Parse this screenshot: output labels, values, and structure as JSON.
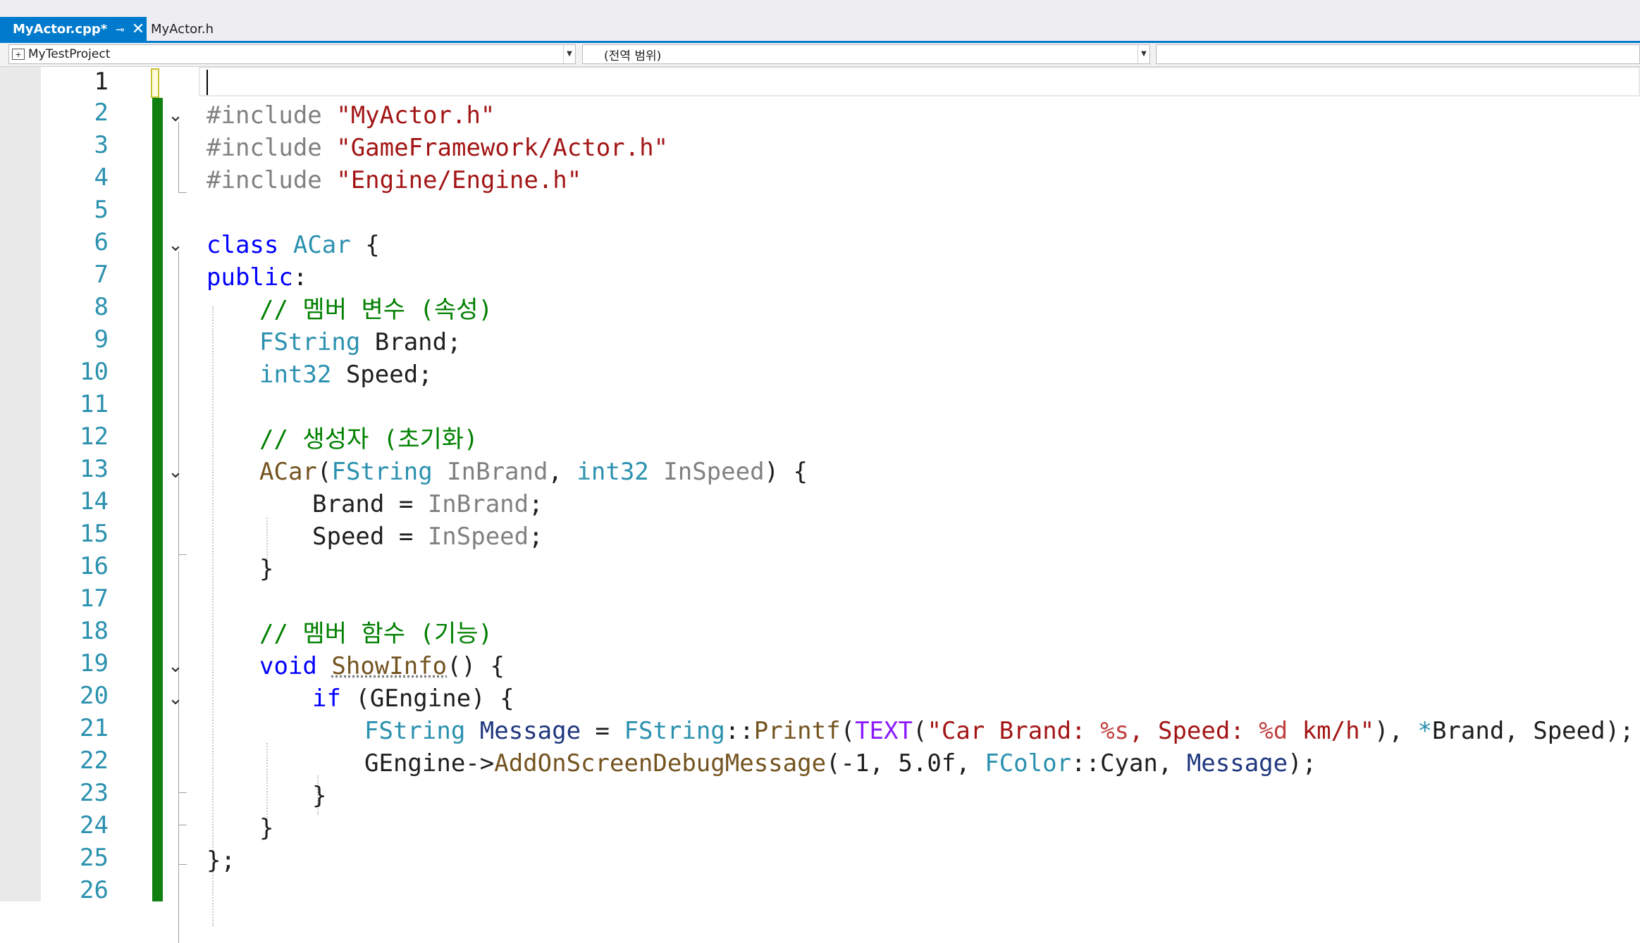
{
  "tabs": [
    {
      "label": "MyActor.cpp*",
      "pin": "⊸",
      "close": "✕"
    },
    {
      "label": "MyActor.h"
    }
  ],
  "nav": {
    "project": "MyTestProject",
    "scope": "(전역 범위)",
    "member": ""
  },
  "line_numbers": [
    "1",
    "2",
    "3",
    "4",
    "5",
    "6",
    "7",
    "8",
    "9",
    "10",
    "11",
    "12",
    "13",
    "14",
    "15",
    "16",
    "17",
    "18",
    "19",
    "20",
    "21",
    "22",
    "23",
    "24",
    "25",
    "26"
  ],
  "code": {
    "l2": [
      "#include ",
      "\"MyActor.h\""
    ],
    "l3": [
      "#include ",
      "\"GameFramework/Actor.h\""
    ],
    "l4": [
      "#include ",
      "\"Engine/Engine.h\""
    ],
    "l6": [
      "class",
      " ",
      "ACar",
      " {"
    ],
    "l7": [
      "public",
      ":"
    ],
    "l8": [
      "// 멤버 변수 (속성)"
    ],
    "l9": [
      "FString",
      " Brand;"
    ],
    "l10": [
      "int32",
      " Speed;"
    ],
    "l12": [
      "// 생성자 (초기화)"
    ],
    "l13": [
      "ACar",
      "(",
      "FString",
      " ",
      "InBrand",
      ", ",
      "int32",
      " ",
      "InSpeed",
      ") {"
    ],
    "l14": [
      "Brand",
      " ",
      "=",
      " ",
      "InBrand",
      ";"
    ],
    "l15": [
      "Speed",
      " ",
      "=",
      " ",
      "InSpeed",
      ";"
    ],
    "l16": [
      "}"
    ],
    "l18": [
      "// 멤버 함수 (기능)"
    ],
    "l19": [
      "void",
      " ",
      "ShowInfo",
      "() {"
    ],
    "l20": [
      "if",
      " (GEngine) {"
    ],
    "l21": [
      "FString",
      " ",
      "Message",
      " = ",
      "FString",
      "::",
      "Printf",
      "(",
      "TEXT",
      "(",
      "\"Car Brand: ",
      "%s",
      ", Speed: ",
      "%d",
      " km/h\"",
      "), ",
      "*",
      "Brand, Speed);"
    ],
    "l22": [
      "GEngine->",
      "AddOnScreenDebugMessage",
      "(-1, 5.0f, ",
      "FColor",
      "::",
      "Cyan, ",
      "Message",
      ");"
    ],
    "l23": [
      "}"
    ],
    "l24": [
      "}"
    ],
    "l25": [
      "};"
    ]
  },
  "colors": {
    "accent": "#007acc",
    "keyword": "#0000ff",
    "type": "#2b91af",
    "string": "#a31515",
    "comment": "#008000",
    "change_bar": "#108010"
  }
}
